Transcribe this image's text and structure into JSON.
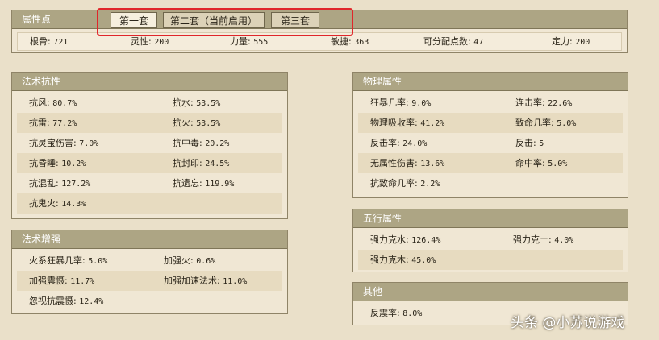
{
  "attributes_panel": {
    "title": "属性点",
    "tabs": [
      {
        "label": "第一套"
      },
      {
        "label": "第二套（当前启用）"
      },
      {
        "label": "第三套"
      }
    ],
    "stats": [
      {
        "label": "根骨:",
        "value": "721"
      },
      {
        "label": "灵性:",
        "value": "200"
      },
      {
        "label": "力量:",
        "value": "555"
      },
      {
        "label": "敏捷:",
        "value": "363"
      },
      {
        "label": "可分配点数:",
        "value": "47"
      },
      {
        "label": "定力:",
        "value": "200"
      }
    ]
  },
  "spell_resistance": {
    "title": "法术抗性",
    "rows": [
      [
        {
          "label": "抗风:",
          "value": "80.7%"
        },
        {
          "label": "抗水:",
          "value": "53.5%"
        }
      ],
      [
        {
          "label": "抗雷:",
          "value": "77.2%"
        },
        {
          "label": "抗火:",
          "value": "53.5%"
        }
      ],
      [
        {
          "label": "抗灵宝伤害:",
          "value": "7.0%"
        },
        {
          "label": "抗中毒:",
          "value": "20.2%"
        }
      ],
      [
        {
          "label": "抗昏睡:",
          "value": "10.2%"
        },
        {
          "label": "抗封印:",
          "value": "24.5%"
        }
      ],
      [
        {
          "label": "抗混乱:",
          "value": "127.2%"
        },
        {
          "label": "抗遗忘:",
          "value": "119.9%"
        }
      ],
      [
        {
          "label": "抗鬼火:",
          "value": "14.3%"
        }
      ]
    ]
  },
  "spell_enhance": {
    "title": "法术增强",
    "rows": [
      [
        {
          "label": "火系狂暴几率:",
          "value": "5.0%"
        },
        {
          "label": "加强火:",
          "value": "0.6%"
        }
      ],
      [
        {
          "label": "加强震慑:",
          "value": "11.7%"
        },
        {
          "label": "加强加速法术:",
          "value": "11.0%"
        }
      ],
      [
        {
          "label": "忽视抗震慑:",
          "value": "12.4%"
        }
      ]
    ]
  },
  "physical": {
    "title": "物理属性",
    "rows": [
      [
        {
          "label": "狂暴几率:",
          "value": "9.0%"
        },
        {
          "label": "连击率:",
          "value": "22.6%"
        }
      ],
      [
        {
          "label": "物理吸收率:",
          "value": "41.2%"
        },
        {
          "label": "致命几率:",
          "value": "5.0%"
        }
      ],
      [
        {
          "label": "反击率:",
          "value": "24.0%"
        },
        {
          "label": "反击:",
          "value": "5"
        }
      ],
      [
        {
          "label": "无属性伤害:",
          "value": "13.6%"
        },
        {
          "label": "命中率:",
          "value": "5.0%"
        }
      ],
      [
        {
          "label": "抗致命几率:",
          "value": "2.2%"
        }
      ]
    ]
  },
  "five_elements": {
    "title": "五行属性",
    "rows": [
      [
        {
          "label": "强力克水:",
          "value": "126.4%"
        },
        {
          "label": "强力克土:",
          "value": "4.0%"
        }
      ],
      [
        {
          "label": "强力克木:",
          "value": "45.0%"
        }
      ]
    ]
  },
  "other": {
    "title": "其他",
    "rows": [
      [
        {
          "label": "反震率:",
          "value": "8.0%"
        }
      ]
    ]
  },
  "watermark": "头条 @小苏说游戏",
  "colors": {
    "background": "#eae0c9",
    "panel_header": "#ada584",
    "highlight_box": "#e0262a"
  }
}
